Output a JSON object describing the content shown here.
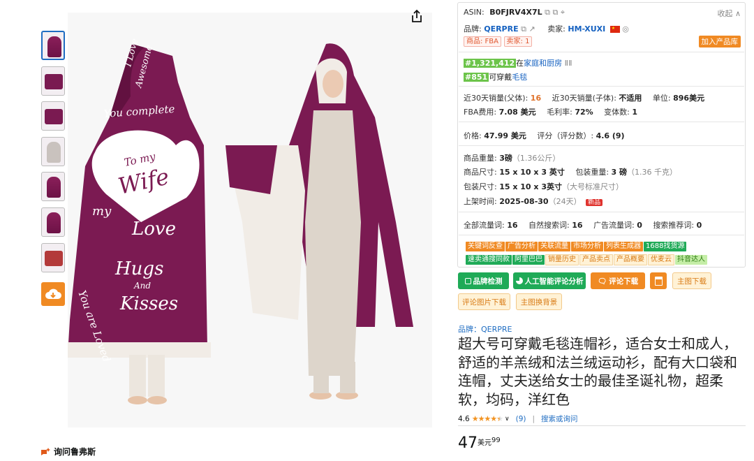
{
  "gallery": {
    "thumb_count": 7,
    "ask_label": "询问鲁弗斯"
  },
  "image_text": {
    "top_love": "I Love",
    "awesome": "Awesome",
    "you_complete": "You complete",
    "to_my": "To my",
    "wife": "Wife",
    "love": "Love",
    "my": "my",
    "hugs": "Hugs",
    "and": "And",
    "kisses": "Kisses",
    "you_are_loved": "You are Loved"
  },
  "panel": {
    "asin_label": "ASIN:",
    "asin": "B0FJRV4X7L",
    "collapse": "收起",
    "brand_label": "品牌:",
    "brand": "QERPRE",
    "seller_label": "卖家:",
    "seller": "HM-XUXI",
    "tag_product": "商品: FBA",
    "tag_seller": "卖家: 1",
    "add_to_library": "加入产品库",
    "rank1": "#1,321,412",
    "rank1_in": "在",
    "rank1_cat": "家庭和厨房",
    "rank2": "#851",
    "rank2_pre": "可穿戴",
    "rank2_cat": "毛毯",
    "sales_parent_label": "近30天销量(父体):",
    "sales_parent": "16",
    "sales_child_label": "近30天销量(子体):",
    "sales_child": "不适用",
    "unit_label": "单位:",
    "unit": "896美元",
    "fba_label": "FBA费用:",
    "fba": "7.08 美元",
    "margin_label": "毛利率:",
    "margin": "72%",
    "variants_label": "变体数:",
    "variants": "1",
    "price_label": "价格:",
    "price": "47.99 美元",
    "rating_label": "评分（评分数）:",
    "rating": "4.6 (9)",
    "weight_label": "商品重量:",
    "weight": "3磅",
    "weight_alt": "（1.36公斤）",
    "dims_label": "商品尺寸:",
    "dims": "15 x 10 x 3 英寸",
    "pkg_weight_label": "包装重量:",
    "pkg_weight": "3 磅",
    "pkg_weight_alt": "（1.36 千克）",
    "pkg_dims_label": "包装尺寸:",
    "pkg_dims": "15 x 10 x 3英寸",
    "pkg_dims_alt": "（大号标准尺寸）",
    "listed_label": "上架时间:",
    "listed": "2025-08-30",
    "listed_days": "（24天）",
    "new_tag": "新品",
    "kw_all_label": "全部流量词:",
    "kw_all": "16",
    "kw_natural_label": "自然搜索词:",
    "kw_natural": "16",
    "kw_ad_label": "广告流量词:",
    "kw_ad": "0",
    "kw_rec_label": "搜索推荐词:",
    "kw_rec": "0",
    "tools_row1": [
      "关键词反查",
      "广告分析",
      "关联流量",
      "市场分析",
      "列表生成器",
      "1688找货源"
    ],
    "tools_row2": [
      "速卖通搜同款",
      "阿里巴巴",
      "销量历史",
      "产品卖点",
      "产品概要",
      "优麦云",
      "抖音达人"
    ]
  },
  "actions": {
    "brand_check": "品牌检测",
    "ai_review": "人工智能评论分析",
    "review_download": "评论下载",
    "main_img_download": "主图下载",
    "review_img_download": "评论图片下载",
    "main_img_bg": "主图换背景"
  },
  "product": {
    "brand_line": "品牌：QERPRE",
    "title": "超大号可穿戴毛毯连帽衫，适合女士和成人，舒适的羊羔绒和法兰绒运动衫，配有大口袋和连帽，丈夫送给女士的最佳圣诞礼物，超柔软，均码，洋红色",
    "rating": "4.6",
    "stars": 4.5,
    "reviews": "(9)",
    "search_ask": "搜索或询问",
    "price_whole": "47",
    "price_unit": "美元",
    "price_frac": "99"
  },
  "colors": {
    "accent_orange": "#f08a23",
    "link_blue": "#1561c0",
    "green": "#1faa57",
    "magenta": "#7a1a51"
  }
}
